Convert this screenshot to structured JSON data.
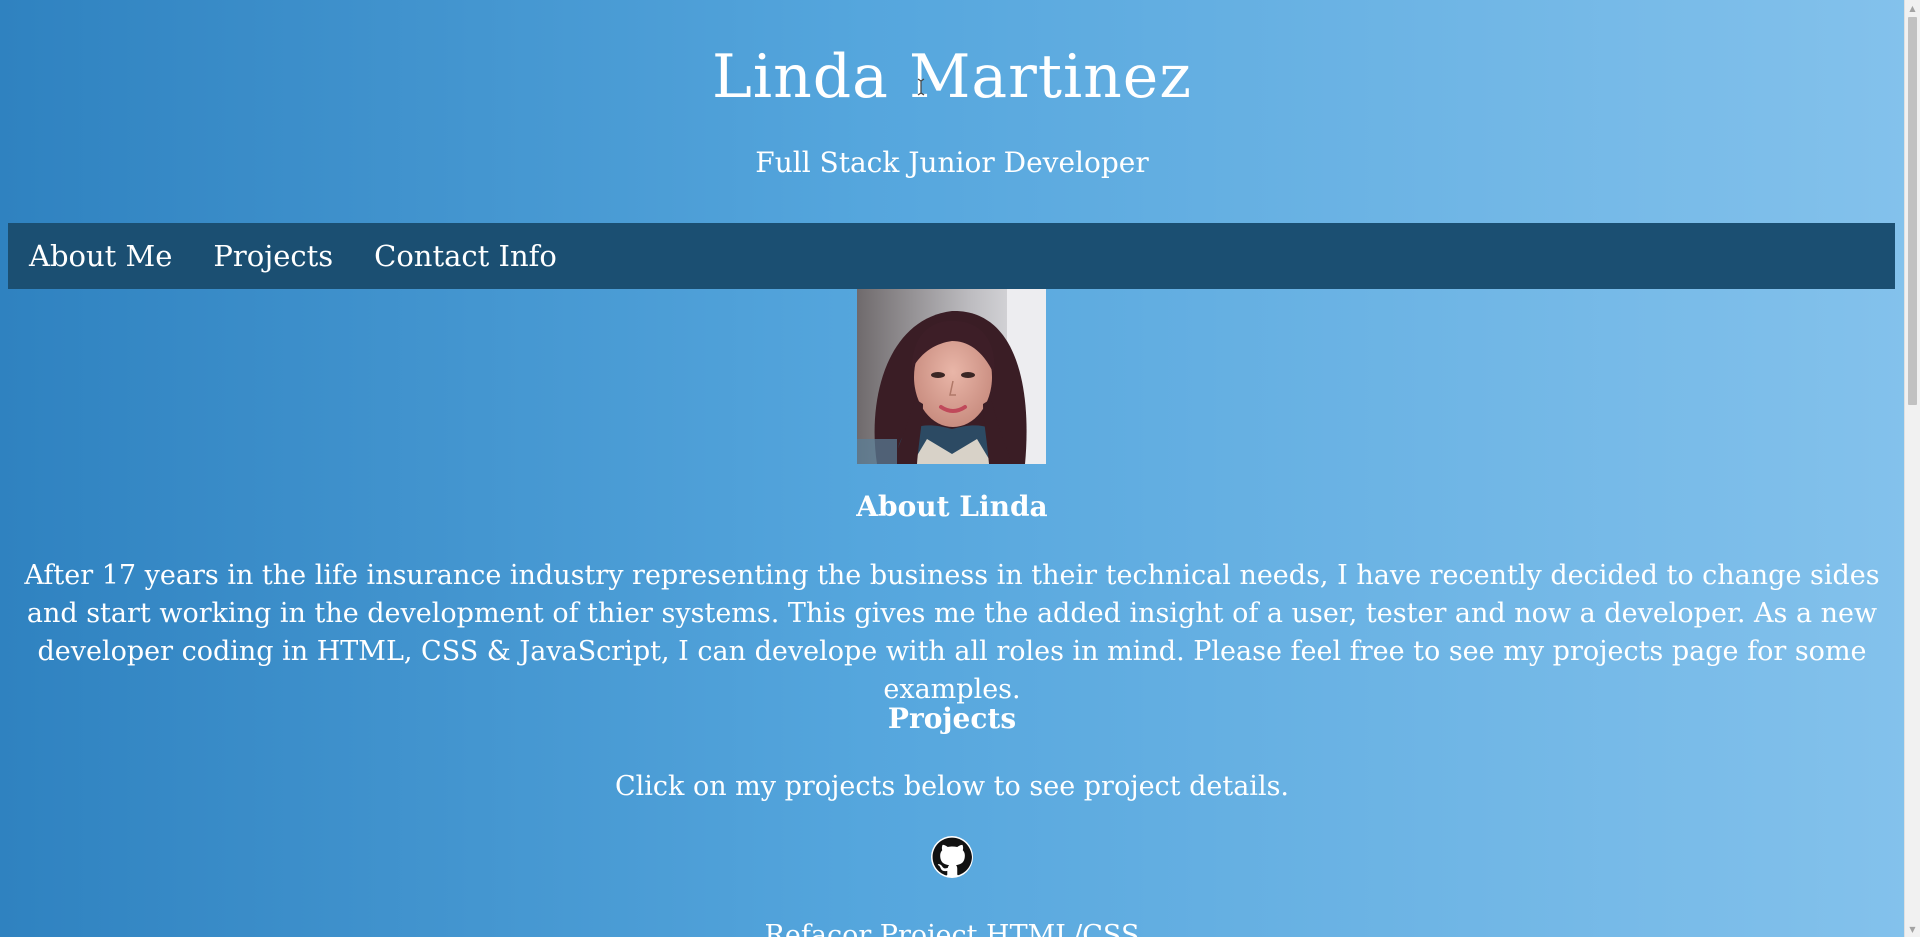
{
  "header": {
    "title": "Linda Martinez",
    "subtitle": "Full Stack Junior Developer"
  },
  "nav": {
    "items": [
      {
        "label": "About Me"
      },
      {
        "label": "Projects"
      },
      {
        "label": "Contact Info"
      }
    ]
  },
  "about": {
    "heading": "About Linda",
    "text": "After 17 years in the life insurance industry representing the business in their technical needs, I have recently decided to change sides and start working in the development of thier systems. This gives me the added insight of a user, tester and now a developer. As a new developer coding in HTML, CSS & JavaScript, I can develope with all roles in mind. Please feel free to see my projects page for some examples."
  },
  "projects": {
    "heading": "Projects",
    "intro": "Click on my projects below to see project details.",
    "items": [
      {
        "title": "Refacor Project HTML/CSS",
        "icon": "github-icon"
      }
    ]
  },
  "colors": {
    "navbar": "#1b4f72",
    "gradient_start": "#2f82c0",
    "gradient_end": "#84c2ec"
  }
}
